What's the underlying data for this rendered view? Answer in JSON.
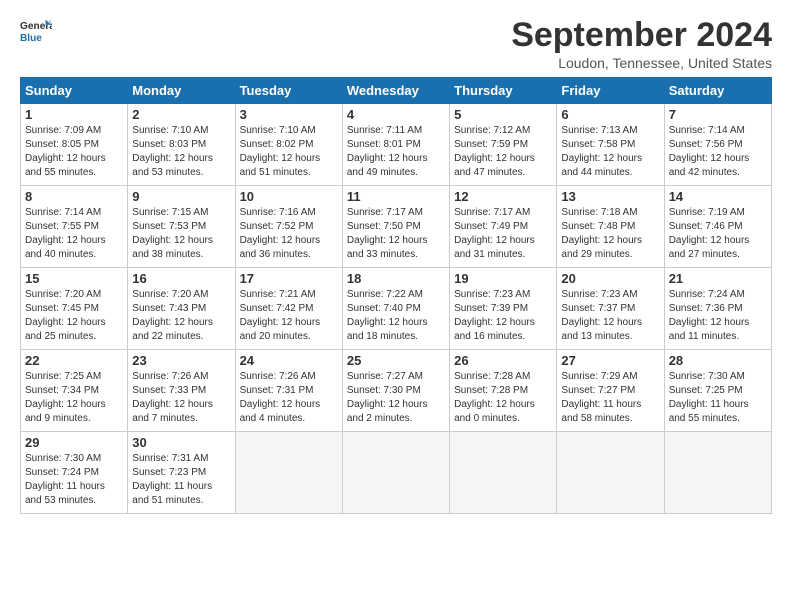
{
  "logo": {
    "general": "General",
    "blue": "Blue"
  },
  "title": "September 2024",
  "location": "Loudon, Tennessee, United States",
  "headers": [
    "Sunday",
    "Monday",
    "Tuesday",
    "Wednesday",
    "Thursday",
    "Friday",
    "Saturday"
  ],
  "weeks": [
    [
      {
        "day": "1",
        "info": "Sunrise: 7:09 AM\nSunset: 8:05 PM\nDaylight: 12 hours\nand 55 minutes."
      },
      {
        "day": "2",
        "info": "Sunrise: 7:10 AM\nSunset: 8:03 PM\nDaylight: 12 hours\nand 53 minutes."
      },
      {
        "day": "3",
        "info": "Sunrise: 7:10 AM\nSunset: 8:02 PM\nDaylight: 12 hours\nand 51 minutes."
      },
      {
        "day": "4",
        "info": "Sunrise: 7:11 AM\nSunset: 8:01 PM\nDaylight: 12 hours\nand 49 minutes."
      },
      {
        "day": "5",
        "info": "Sunrise: 7:12 AM\nSunset: 7:59 PM\nDaylight: 12 hours\nand 47 minutes."
      },
      {
        "day": "6",
        "info": "Sunrise: 7:13 AM\nSunset: 7:58 PM\nDaylight: 12 hours\nand 44 minutes."
      },
      {
        "day": "7",
        "info": "Sunrise: 7:14 AM\nSunset: 7:56 PM\nDaylight: 12 hours\nand 42 minutes."
      }
    ],
    [
      {
        "day": "8",
        "info": "Sunrise: 7:14 AM\nSunset: 7:55 PM\nDaylight: 12 hours\nand 40 minutes."
      },
      {
        "day": "9",
        "info": "Sunrise: 7:15 AM\nSunset: 7:53 PM\nDaylight: 12 hours\nand 38 minutes."
      },
      {
        "day": "10",
        "info": "Sunrise: 7:16 AM\nSunset: 7:52 PM\nDaylight: 12 hours\nand 36 minutes."
      },
      {
        "day": "11",
        "info": "Sunrise: 7:17 AM\nSunset: 7:50 PM\nDaylight: 12 hours\nand 33 minutes."
      },
      {
        "day": "12",
        "info": "Sunrise: 7:17 AM\nSunset: 7:49 PM\nDaylight: 12 hours\nand 31 minutes."
      },
      {
        "day": "13",
        "info": "Sunrise: 7:18 AM\nSunset: 7:48 PM\nDaylight: 12 hours\nand 29 minutes."
      },
      {
        "day": "14",
        "info": "Sunrise: 7:19 AM\nSunset: 7:46 PM\nDaylight: 12 hours\nand 27 minutes."
      }
    ],
    [
      {
        "day": "15",
        "info": "Sunrise: 7:20 AM\nSunset: 7:45 PM\nDaylight: 12 hours\nand 25 minutes."
      },
      {
        "day": "16",
        "info": "Sunrise: 7:20 AM\nSunset: 7:43 PM\nDaylight: 12 hours\nand 22 minutes."
      },
      {
        "day": "17",
        "info": "Sunrise: 7:21 AM\nSunset: 7:42 PM\nDaylight: 12 hours\nand 20 minutes."
      },
      {
        "day": "18",
        "info": "Sunrise: 7:22 AM\nSunset: 7:40 PM\nDaylight: 12 hours\nand 18 minutes."
      },
      {
        "day": "19",
        "info": "Sunrise: 7:23 AM\nSunset: 7:39 PM\nDaylight: 12 hours\nand 16 minutes."
      },
      {
        "day": "20",
        "info": "Sunrise: 7:23 AM\nSunset: 7:37 PM\nDaylight: 12 hours\nand 13 minutes."
      },
      {
        "day": "21",
        "info": "Sunrise: 7:24 AM\nSunset: 7:36 PM\nDaylight: 12 hours\nand 11 minutes."
      }
    ],
    [
      {
        "day": "22",
        "info": "Sunrise: 7:25 AM\nSunset: 7:34 PM\nDaylight: 12 hours\nand 9 minutes."
      },
      {
        "day": "23",
        "info": "Sunrise: 7:26 AM\nSunset: 7:33 PM\nDaylight: 12 hours\nand 7 minutes."
      },
      {
        "day": "24",
        "info": "Sunrise: 7:26 AM\nSunset: 7:31 PM\nDaylight: 12 hours\nand 4 minutes."
      },
      {
        "day": "25",
        "info": "Sunrise: 7:27 AM\nSunset: 7:30 PM\nDaylight: 12 hours\nand 2 minutes."
      },
      {
        "day": "26",
        "info": "Sunrise: 7:28 AM\nSunset: 7:28 PM\nDaylight: 12 hours\nand 0 minutes."
      },
      {
        "day": "27",
        "info": "Sunrise: 7:29 AM\nSunset: 7:27 PM\nDaylight: 11 hours\nand 58 minutes."
      },
      {
        "day": "28",
        "info": "Sunrise: 7:30 AM\nSunset: 7:25 PM\nDaylight: 11 hours\nand 55 minutes."
      }
    ],
    [
      {
        "day": "29",
        "info": "Sunrise: 7:30 AM\nSunset: 7:24 PM\nDaylight: 11 hours\nand 53 minutes."
      },
      {
        "day": "30",
        "info": "Sunrise: 7:31 AM\nSunset: 7:23 PM\nDaylight: 11 hours\nand 51 minutes."
      },
      {
        "day": "",
        "info": ""
      },
      {
        "day": "",
        "info": ""
      },
      {
        "day": "",
        "info": ""
      },
      {
        "day": "",
        "info": ""
      },
      {
        "day": "",
        "info": ""
      }
    ]
  ]
}
